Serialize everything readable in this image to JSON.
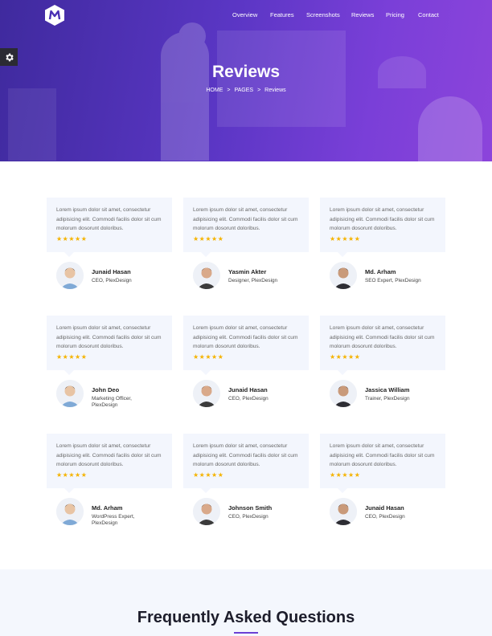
{
  "nav": {
    "items": [
      "Overview",
      "Features",
      "Screenshots",
      "Reviews",
      "Pricing",
      "Contact"
    ]
  },
  "hero": {
    "title": "Reviews",
    "breadcrumb": [
      "HOME",
      "PAGES",
      "Reviews"
    ],
    "separator": ">"
  },
  "review_text": "Lorem ipsum dolor sit amet, consectetur adipisicing elit. Commodi facilis dolor sit cum molorum dosorunt doloribus.",
  "stars": "★★★★★",
  "reviews": [
    {
      "name": "Junaid Hasan",
      "role": "CEO, PlexDesign"
    },
    {
      "name": "Yasmin Akter",
      "role": "Designer, PlexDesign"
    },
    {
      "name": "Md. Arham",
      "role": "SEO Expert, PlexDesign"
    },
    {
      "name": "John Deo",
      "role": "Marketing Officer, PlexDesign"
    },
    {
      "name": "Junaid Hasan",
      "role": "CEO, PlexDesign"
    },
    {
      "name": "Jassica William",
      "role": "Trainer, PlexDesign"
    },
    {
      "name": "Md. Arham",
      "role": "WordPress Expert, PlexDesign"
    },
    {
      "name": "Johnson Smith",
      "role": "CEO, PlexDesign"
    },
    {
      "name": "Junaid Hasan",
      "role": "CEO, PlexDesign"
    }
  ],
  "faq": {
    "title": "Frequently Asked Questions"
  },
  "colors": {
    "accent": "#6b3fd4",
    "star": "#f5b301",
    "card_bg": "#f3f6fd"
  }
}
